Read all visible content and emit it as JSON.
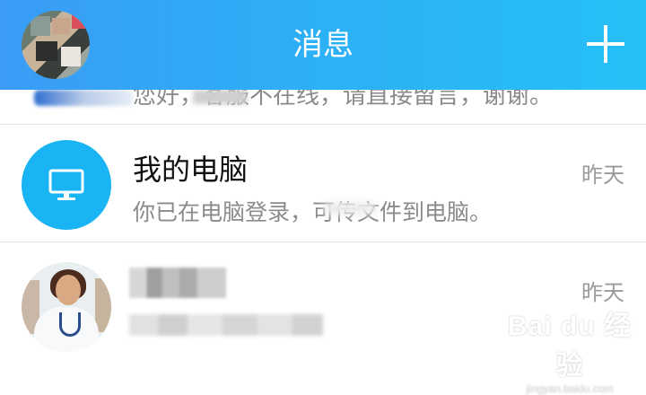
{
  "header": {
    "title": "消息",
    "avatar_icon": "user-avatar",
    "add_icon": "plus-icon"
  },
  "partial_row": {
    "preview_fragment": "您好，客服不在线，请直接留言，谢谢。"
  },
  "conversations": [
    {
      "name": "我的电脑",
      "preview": "你已在电脑登录，可传文件到电脑。",
      "time": "昨天",
      "icon": "monitor-icon",
      "icon_color": "#18b4f3"
    },
    {
      "name": "",
      "preview": "",
      "time": "昨天",
      "icon": "contact-avatar"
    }
  ],
  "watermark": {
    "logo": "Bai du 经验",
    "url": "jingyan.baidu.com"
  },
  "colors": {
    "header_gradient_start": "#3a9cf5",
    "header_gradient_end": "#26c0f8",
    "accent": "#18b4f3"
  }
}
